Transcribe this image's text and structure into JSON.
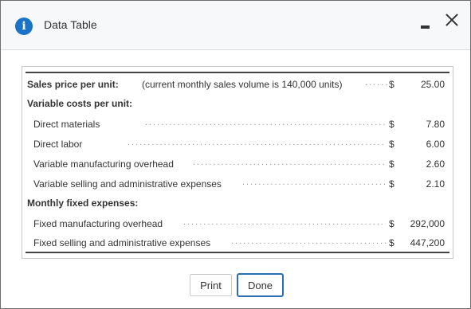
{
  "dialog": {
    "title": "Data Table",
    "colors": {
      "info_icon": "#1a73c7",
      "done_border": "#2c6fb3"
    },
    "icons": [
      "info-icon",
      "minimize-icon",
      "close-icon"
    ]
  },
  "table": {
    "rows": [
      {
        "label": "Sales price per unit:",
        "note": "(current monthly sales volume is 140,000 units)",
        "currency": "$",
        "value": "25.00",
        "bold": true
      },
      {
        "label": "Variable costs per unit:",
        "bold": true
      },
      {
        "label": "Direct materials",
        "currency": "$",
        "value": "7.80"
      },
      {
        "label": "Direct labor",
        "currency": "$",
        "value": "6.00"
      },
      {
        "label": "Variable manufacturing overhead",
        "currency": "$",
        "value": "2.60"
      },
      {
        "label": "Variable selling and administrative expenses",
        "currency": "$",
        "value": "2.10"
      },
      {
        "label": "Monthly fixed expenses:",
        "bold": true
      },
      {
        "label": "Fixed manufacturing overhead",
        "currency": "$",
        "value": "292,000"
      },
      {
        "label": "Fixed selling and administrative expenses",
        "currency": "$",
        "value": "447,200"
      }
    ]
  },
  "buttons": {
    "print": "Print",
    "done": "Done"
  }
}
